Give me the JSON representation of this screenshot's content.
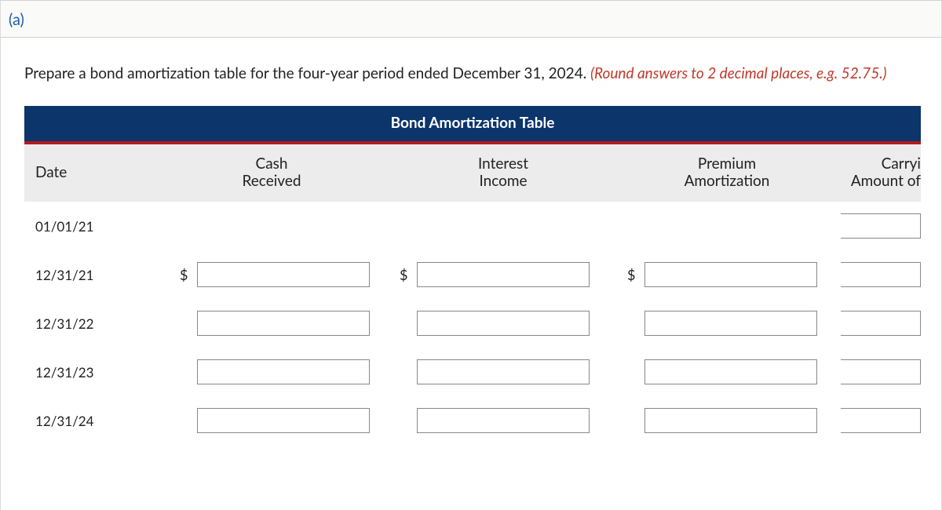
{
  "part_label": "(a)",
  "instruction_main": "Prepare a bond amortization table for the four-year period ended December 31, 2024. ",
  "instruction_hint": "(Round answers to 2 decimal places, e.g. 52.75.)",
  "table_title": "Bond Amortization Table",
  "columns": {
    "date": "Date",
    "cash_line1": "Cash",
    "cash_line2": "Received",
    "interest_line1": "Interest",
    "interest_line2": "Income",
    "premium_line1": "Premium",
    "premium_line2": "Amortization",
    "carry_line1": "Carryi",
    "carry_line2": "Amount of"
  },
  "currency_symbol": "$",
  "rows": [
    {
      "date": "01/01/21",
      "show_cash": false,
      "show_int": false,
      "show_prem": false,
      "show_carry": true,
      "show_dollar": true
    },
    {
      "date": "12/31/21",
      "show_cash": true,
      "show_int": true,
      "show_prem": true,
      "show_carry": true,
      "show_dollar": true
    },
    {
      "date": "12/31/22",
      "show_cash": true,
      "show_int": true,
      "show_prem": true,
      "show_carry": true,
      "show_dollar": false
    },
    {
      "date": "12/31/23",
      "show_cash": true,
      "show_int": true,
      "show_prem": true,
      "show_carry": true,
      "show_dollar": false
    },
    {
      "date": "12/31/24",
      "show_cash": true,
      "show_int": true,
      "show_prem": true,
      "show_carry": true,
      "show_dollar": false
    }
  ]
}
